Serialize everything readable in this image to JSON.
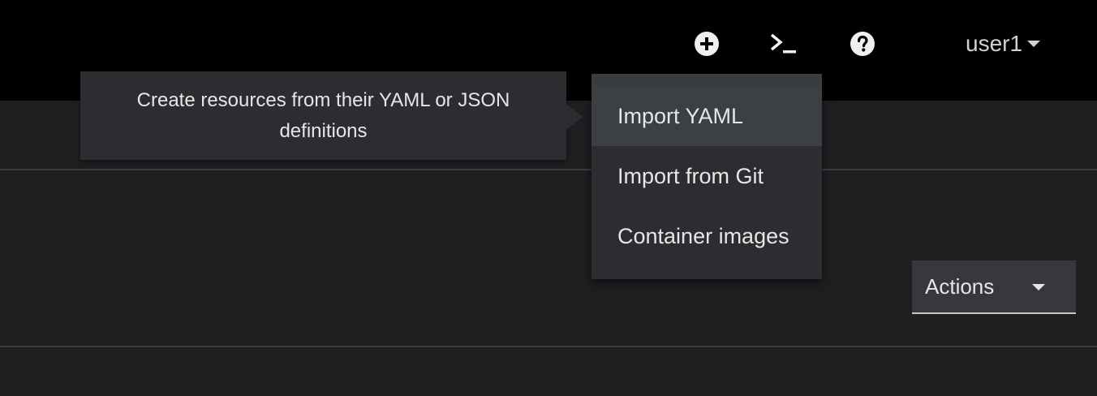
{
  "masthead": {
    "icons": [
      "plus-circle-icon",
      "terminal-icon",
      "help-icon"
    ],
    "user": "user1"
  },
  "tooltip": {
    "text": "Create resources from their YAML or JSON definitions"
  },
  "add_menu": {
    "items": [
      "Import YAML",
      "Import from Git",
      "Container images"
    ]
  },
  "actions": {
    "label": "Actions"
  }
}
